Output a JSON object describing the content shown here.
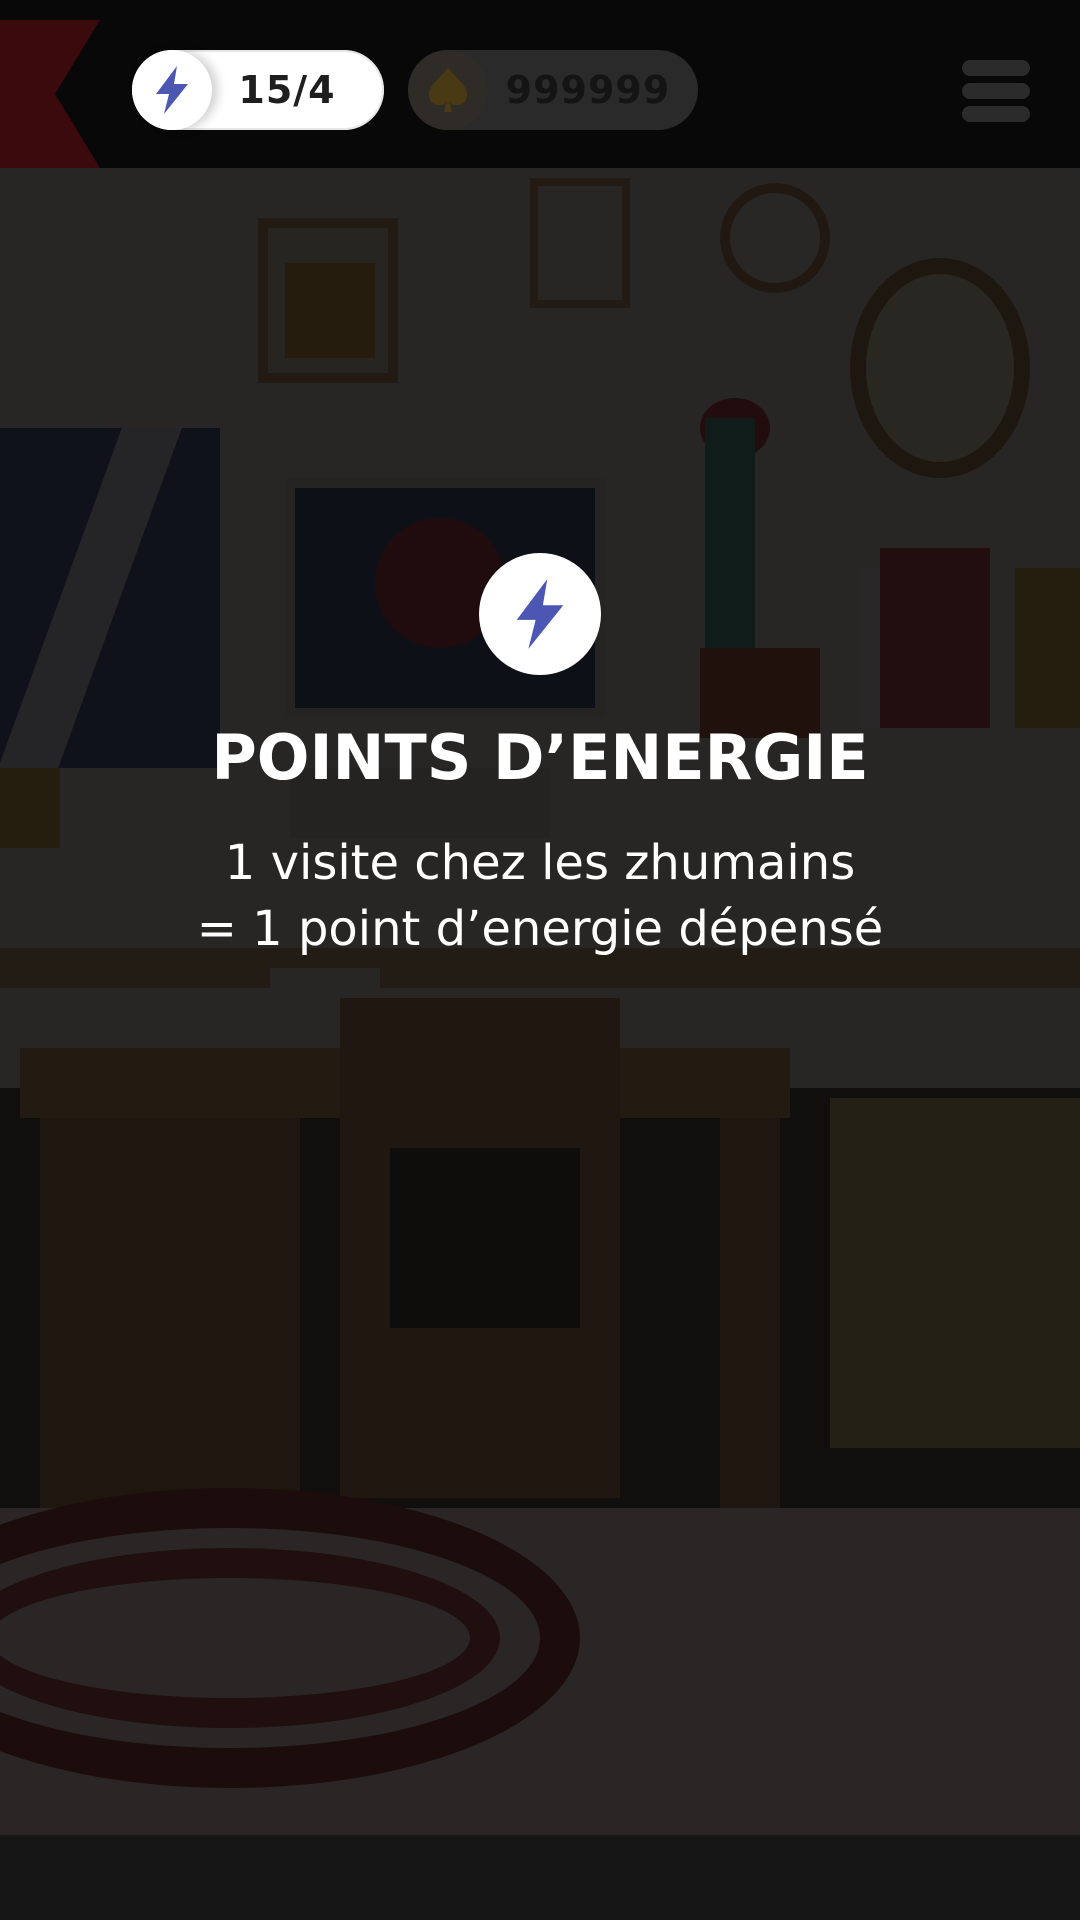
{
  "header": {
    "energy": {
      "icon": "lightning-bolt-icon",
      "value": "15/4"
    },
    "coins": {
      "icon": "spade-coin-icon",
      "value": "999999"
    },
    "menu_icon": "hamburger-menu-icon"
  },
  "info": {
    "icon": "lightning-bolt-icon",
    "title": "POINTS D’ENERGIE",
    "line1": "1 visite chez les zhumains",
    "line2": "= 1 point d’energie dépensé"
  },
  "colors": {
    "accent": "#4b57b3",
    "overlay": "#0a0909",
    "coin": "#c98c12"
  }
}
